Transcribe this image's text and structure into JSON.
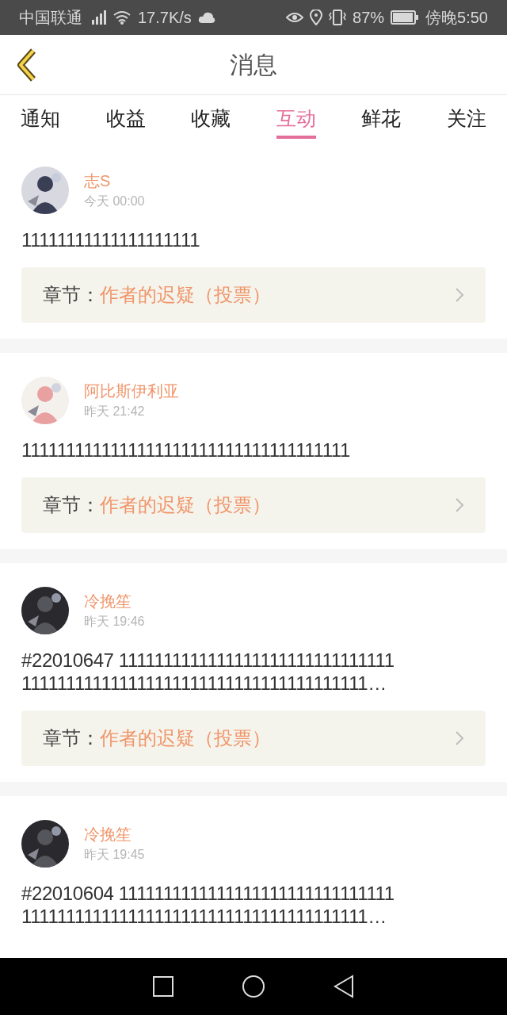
{
  "status_bar": {
    "carrier": "中国联通",
    "speed": "17.7K/s",
    "battery": "87%",
    "time": "傍晚5:50"
  },
  "header": {
    "title": "消息"
  },
  "tabs": [
    {
      "label": "通知",
      "selected": false
    },
    {
      "label": "收益",
      "selected": false
    },
    {
      "label": "收藏",
      "selected": false
    },
    {
      "label": "互动",
      "selected": true
    },
    {
      "label": "鲜花",
      "selected": false
    },
    {
      "label": "关注",
      "selected": false
    }
  ],
  "messages": [
    {
      "user": "志S",
      "time": "今天 00:00",
      "lines": [
        "11111111111111111111"
      ],
      "chapter_label": "章节：",
      "chapter": "作者的迟疑（投票）"
    },
    {
      "user": "阿比斯伊利亚",
      "time": "昨天 21:42",
      "lines": [
        "1111111111111111111111111111111111111"
      ],
      "chapter_label": "章节：",
      "chapter": "作者的迟疑（投票）"
    },
    {
      "user": "冷挽笙",
      "time": "昨天 19:46",
      "lines": [
        "#22010647 1111111111111111111111111111111",
        "111111111111111111111111111111111111111…"
      ],
      "chapter_label": "章节：",
      "chapter": "作者的迟疑（投票）"
    },
    {
      "user": "冷挽笙",
      "time": "昨天 19:45",
      "lines": [
        "#22010604 1111111111111111111111111111111",
        "111111111111111111111111111111111111111…"
      ]
    }
  ]
}
